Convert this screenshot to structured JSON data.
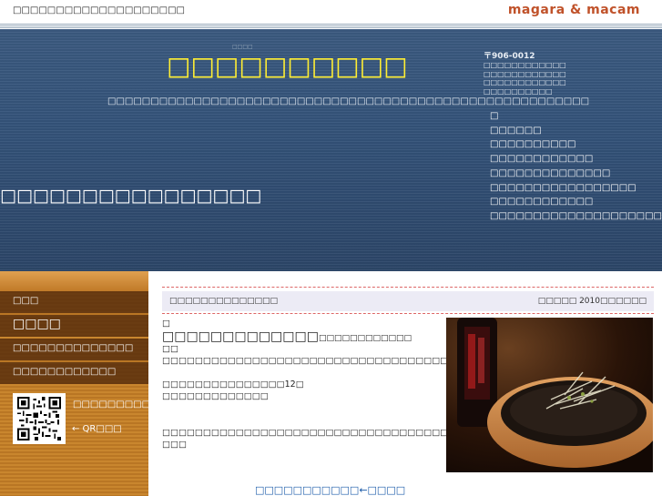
{
  "topbar": {
    "tagline": "□□□□□□□□□□□□□□□□□□□□",
    "brand": "magara & macam"
  },
  "header": {
    "title": "□□□□□□□□□□",
    "title_small": "□□□□",
    "description": "□□□□□□□□□□□□□□□□□□□□□□□□□□□□□□□□□□□□□□□□□□□□□□□□□□□□□□□□",
    "catchcopy": "□□□□□□□□□□□□□□□□"
  },
  "info": {
    "postal": "〒906-0012",
    "address_lines": [
      "□□□□□□□□□□□□",
      "□□□□□□□□□□□□",
      "□□□□□□□□□□□□",
      "□□□□□□□□□□"
    ]
  },
  "nav": {
    "items": [
      "□",
      "□□□□□□",
      "□□□□□□□□□□",
      "□□□□□□□□□□□□",
      "□□□□□□□□□□□□□□",
      "□□□□□□□□□□□□□□□□□",
      "□□□□□□□□□□□□",
      "□□□□□□□□□□□□□□□□□□□□"
    ]
  },
  "sidebar": {
    "items": [
      "□□□",
      "□□□□",
      "□□□□□□□□□□□□□□",
      "□□□□□□□□□□□□"
    ],
    "qr_label": "□□□□□□□□□□",
    "qr_link": "← QR□□□"
  },
  "entry": {
    "title": "□□□□□□□□□□□□□□",
    "date": "□□□□□ 2010□□□□□□",
    "marker": "□",
    "heading": "□□□□□□□□□□□□□",
    "heading_sub": "□□□□□□□□□□□□",
    "line1": "□□",
    "line2": "□□□□□□□□□□□□□□□□□□□□□□□□□□□□□□□□□□□□□□□□□□□□□□□□□□□",
    "line3": "□□□□□□□□□□□□□□□12□",
    "line4": "□□□□□□□□□□□□□",
    "line5": "□□□□□□□□□□□□□□□□□□□□□□□□□□□□□□□□□□□□□□□□□□□□□□□□□□□□□□□□□□",
    "line6": "□□□",
    "more_link": "□□□□□□□□□□□←□□□□"
  },
  "colors": {
    "brand": "#c0522a",
    "title": "#ffee33",
    "header_bg": "#34537a",
    "sidebar_bg": "#c9862e",
    "link": "#1a5aa8",
    "dash": "#dd6666"
  }
}
